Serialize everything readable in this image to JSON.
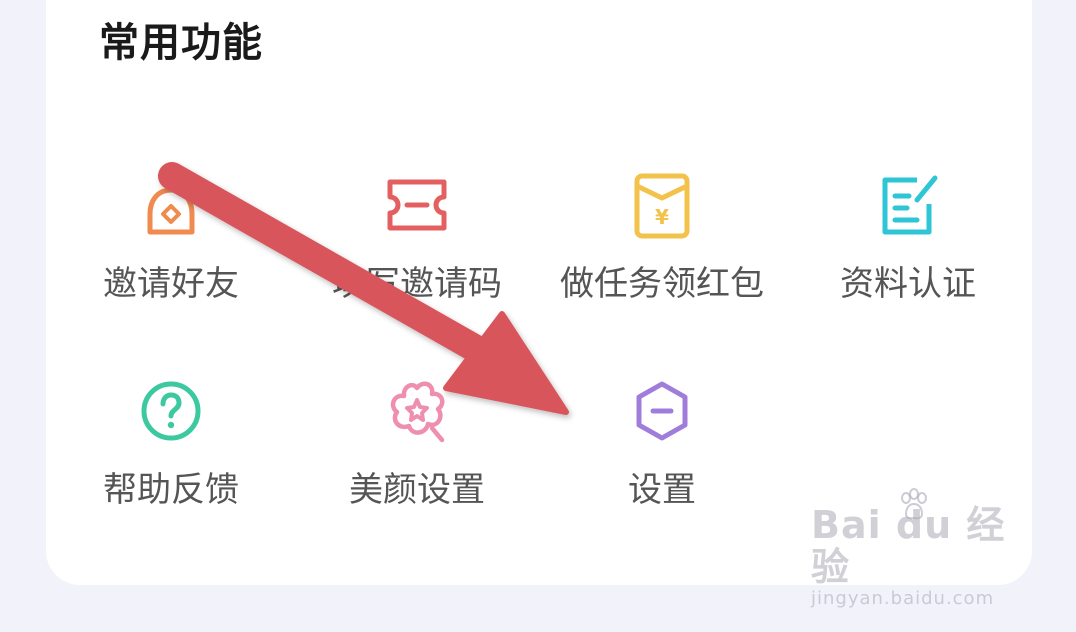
{
  "section_title": "常用功能",
  "features": [
    {
      "label": "邀请好友",
      "icon": "invite-friend-bag-icon",
      "color": "#f08a4f"
    },
    {
      "label": "填写邀请码",
      "icon": "ticket-icon",
      "color": "#e46060"
    },
    {
      "label": "做任务领红包",
      "icon": "red-envelope-yen-icon",
      "color": "#f2c24b"
    },
    {
      "label": "资料认证",
      "icon": "edit-document-icon",
      "color": "#2ec6d6"
    },
    {
      "label": "帮助反馈",
      "icon": "help-question-icon",
      "color": "#3cc9a0"
    },
    {
      "label": "美颜设置",
      "icon": "beauty-flower-icon",
      "color": "#ef8fb0"
    },
    {
      "label": "设置",
      "icon": "settings-hexagon-icon",
      "color": "#a07ddb"
    }
  ],
  "overlay_arrow_color": "#d9545b",
  "watermark": {
    "logo": "Bai du 经验",
    "url": "jingyan.baidu.com"
  }
}
